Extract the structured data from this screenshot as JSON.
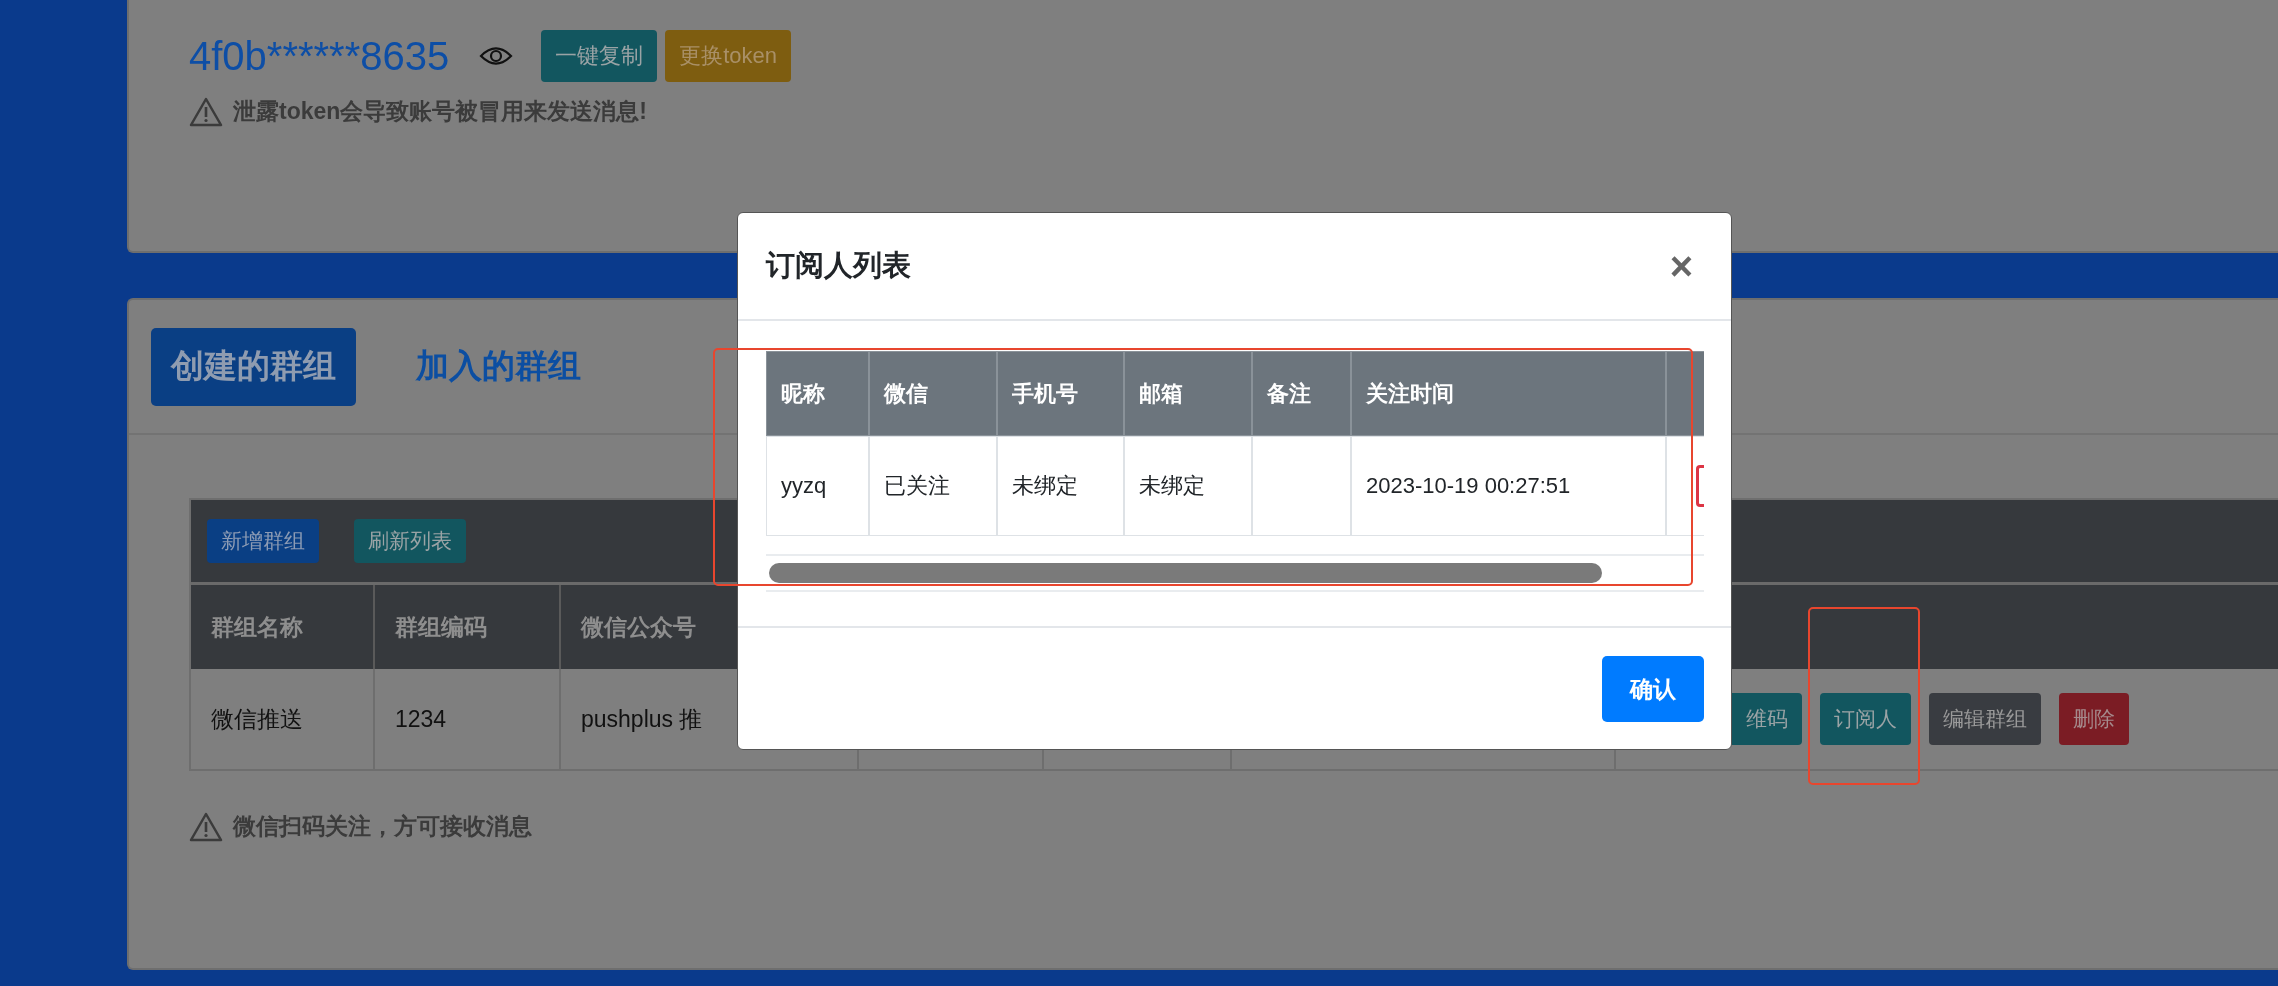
{
  "token_card": {
    "token": "4f0b******8635",
    "buttons": [
      {
        "label": "一键复制",
        "kind": "info"
      },
      {
        "label": "更换token",
        "kind": "warning"
      }
    ],
    "warning": "泄露token会导致账号被冒用来发送消息!"
  },
  "group_tabs": [
    {
      "label": "创建的群组",
      "selected": true
    },
    {
      "label": "加入的群组",
      "selected": false
    }
  ],
  "group_toolbar": [
    {
      "label": "新增群组",
      "kind": "primary"
    },
    {
      "label": "刷新列表",
      "kind": "info"
    }
  ],
  "group_table": {
    "columns": [
      "群组名称",
      "群组编码",
      "微信公众号"
    ],
    "rows": [
      {
        "cells": [
          "微信推送",
          "1234",
          "pushplus 推"
        ],
        "actions": [
          {
            "label": "维码",
            "kind": "info",
            "highlighted": false
          },
          {
            "label": "订阅人",
            "kind": "info",
            "highlighted": true
          },
          {
            "label": "编辑群组",
            "kind": "secondary",
            "highlighted": false
          },
          {
            "label": "删除",
            "kind": "danger",
            "highlighted": false
          }
        ]
      }
    ]
  },
  "group_note": "微信扫码关注，方可接收消息",
  "modal": {
    "title": "订阅人列表",
    "close": "×",
    "table": {
      "highlighted": true,
      "columns": [
        "昵称",
        "微信",
        "手机号",
        "邮箱",
        "备注",
        "关注时间"
      ],
      "rows": [
        {
          "nickname": "yyzq",
          "wechat": "已关注",
          "phone": "未绑定",
          "email": "未绑定",
          "followed_at": "2023-10-19 00:27:51"
        }
      ]
    },
    "confirm": "确认"
  }
}
